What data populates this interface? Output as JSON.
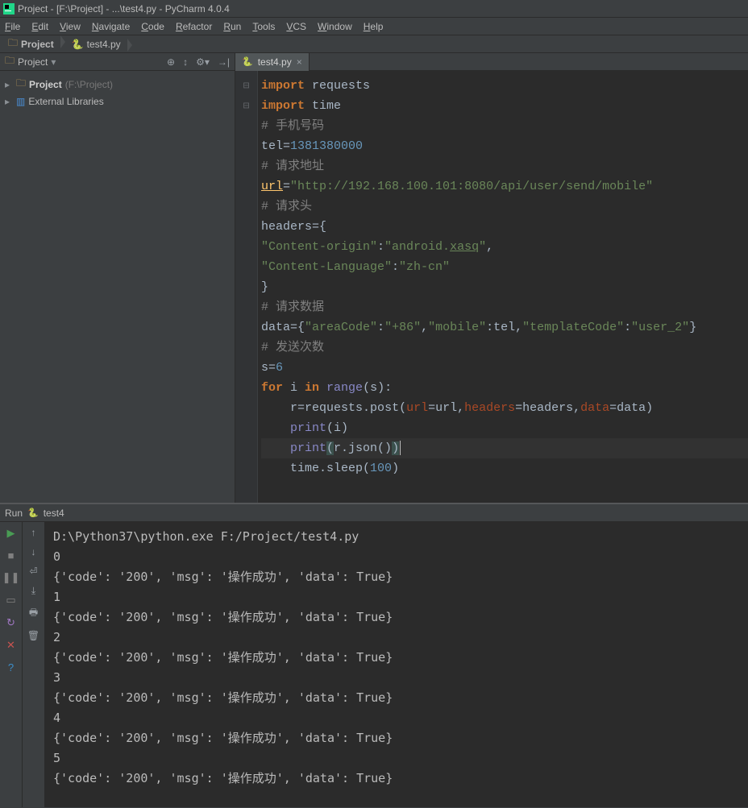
{
  "titlebar": "Project - [F:\\Project] - ...\\test4.py - PyCharm 4.0.4",
  "menu": [
    "File",
    "Edit",
    "View",
    "Navigate",
    "Code",
    "Refactor",
    "Run",
    "Tools",
    "VCS",
    "Window",
    "Help"
  ],
  "breadcrumbs": [
    {
      "icon": "folder",
      "label": "Project"
    },
    {
      "icon": "py",
      "label": "test4.py"
    }
  ],
  "sidebar": {
    "tab_label": "Project",
    "header_icons": [
      "target",
      "autoscroll",
      "gear",
      "hide"
    ],
    "tree": [
      {
        "kind": "project",
        "label": "Project",
        "path": "(F:\\Project)",
        "expanded": true,
        "bold": true
      },
      {
        "kind": "lib",
        "label": "External Libraries",
        "expanded": true
      }
    ]
  },
  "editor": {
    "tab": "test4.py",
    "lines": [
      {
        "type": "import",
        "parts": [
          {
            "t": "import ",
            "cls": "k-import"
          },
          {
            "t": "requests",
            "cls": "ident"
          }
        ]
      },
      {
        "type": "import",
        "parts": [
          {
            "t": "import ",
            "cls": "k-import"
          },
          {
            "t": "time",
            "cls": "ident"
          }
        ]
      },
      {
        "type": "comment",
        "parts": [
          {
            "t": "# 手机号码",
            "cls": "comment"
          }
        ]
      },
      {
        "type": "assign",
        "parts": [
          {
            "t": "tel",
            "cls": "ident"
          },
          {
            "t": "=",
            "cls": "ident"
          },
          {
            "t": "1381380000",
            "cls": "num"
          }
        ]
      },
      {
        "type": "comment",
        "parts": [
          {
            "t": "# 请求地址",
            "cls": "comment"
          }
        ]
      },
      {
        "type": "assign",
        "parts": [
          {
            "t": "url",
            "cls": "warn under"
          },
          {
            "t": "=",
            "cls": "ident"
          },
          {
            "t": "\"http://192.168.100.101:8080/api/user/send/mobile\"",
            "cls": "str"
          }
        ]
      },
      {
        "type": "comment",
        "parts": [
          {
            "t": "# 请求头",
            "cls": "comment"
          }
        ]
      },
      {
        "type": "assign",
        "parts": [
          {
            "t": "headers",
            "cls": "ident"
          },
          {
            "t": "={",
            "cls": "ident"
          }
        ]
      },
      {
        "type": "dict",
        "parts": [
          {
            "t": "\"Content-origin\"",
            "cls": "str"
          },
          {
            "t": ":",
            "cls": "ident"
          },
          {
            "t": "\"android.",
            "cls": "str"
          },
          {
            "t": "xasq",
            "cls": "str under"
          },
          {
            "t": "\"",
            "cls": "str"
          },
          {
            "t": ",",
            "cls": "ident"
          }
        ]
      },
      {
        "type": "dict",
        "parts": [
          {
            "t": "\"Content-Language\"",
            "cls": "str"
          },
          {
            "t": ":",
            "cls": "ident"
          },
          {
            "t": "\"zh-cn\"",
            "cls": "str"
          }
        ]
      },
      {
        "type": "plain",
        "parts": [
          {
            "t": "}",
            "cls": "ident"
          }
        ]
      },
      {
        "type": "comment",
        "parts": [
          {
            "t": "# 请求数据",
            "cls": "comment"
          }
        ]
      },
      {
        "type": "assign",
        "parts": [
          {
            "t": "data",
            "cls": "ident"
          },
          {
            "t": "={",
            "cls": "ident"
          },
          {
            "t": "\"areaCode\"",
            "cls": "str"
          },
          {
            "t": ":",
            "cls": "ident"
          },
          {
            "t": "\"+86\"",
            "cls": "str"
          },
          {
            "t": ",",
            "cls": "ident"
          },
          {
            "t": "\"mobile\"",
            "cls": "str"
          },
          {
            "t": ":tel,",
            "cls": "ident"
          },
          {
            "t": "\"templateCode\"",
            "cls": "str"
          },
          {
            "t": ":",
            "cls": "ident"
          },
          {
            "t": "\"user_2\"",
            "cls": "str"
          },
          {
            "t": "}",
            "cls": "ident"
          }
        ]
      },
      {
        "type": "comment",
        "parts": [
          {
            "t": "# 发送次数",
            "cls": "comment"
          }
        ]
      },
      {
        "type": "assign",
        "parts": [
          {
            "t": "s",
            "cls": "ident"
          },
          {
            "t": "=",
            "cls": "ident"
          },
          {
            "t": "6",
            "cls": "num"
          }
        ]
      },
      {
        "type": "for",
        "parts": [
          {
            "t": "for ",
            "cls": "k-for"
          },
          {
            "t": "i ",
            "cls": "ident"
          },
          {
            "t": "in ",
            "cls": "k-in"
          },
          {
            "t": "range",
            "cls": "builtin"
          },
          {
            "t": "(s):",
            "cls": "ident"
          }
        ]
      },
      {
        "type": "stmt",
        "indent": 1,
        "parts": [
          {
            "t": "r",
            "cls": "ident"
          },
          {
            "t": "=",
            "cls": "ident"
          },
          {
            "t": "requests.post(",
            "cls": "ident"
          },
          {
            "t": "url",
            "cls": "kwarg"
          },
          {
            "t": "=url,",
            "cls": "ident"
          },
          {
            "t": "headers",
            "cls": "kwarg"
          },
          {
            "t": "=headers,",
            "cls": "ident"
          },
          {
            "t": "data",
            "cls": "kwarg"
          },
          {
            "t": "=data)",
            "cls": "ident"
          }
        ]
      },
      {
        "type": "stmt",
        "indent": 1,
        "parts": [
          {
            "t": "print",
            "cls": "builtin"
          },
          {
            "t": "(i)",
            "cls": "ident"
          }
        ]
      },
      {
        "type": "stmt",
        "indent": 1,
        "cursor": true,
        "parts": [
          {
            "t": "print",
            "cls": "builtin"
          },
          {
            "t": "(",
            "cls": "ident paren-hl"
          },
          {
            "t": "r.json()",
            "cls": "ident"
          },
          {
            "t": ")",
            "cls": "ident paren-hl"
          }
        ]
      },
      {
        "type": "stmt",
        "indent": 1,
        "parts": [
          {
            "t": "time.sleep(",
            "cls": "ident"
          },
          {
            "t": "100",
            "cls": "num"
          },
          {
            "t": ")",
            "cls": "ident"
          }
        ]
      }
    ]
  },
  "run": {
    "label": "Run",
    "target": "test4",
    "toolbar_left": [
      "run",
      "stop",
      "pause",
      "layout",
      "rerun",
      "close",
      "help"
    ],
    "toolbar_right": [
      "up",
      "down",
      "wrap",
      "scroll",
      "print",
      "trash"
    ],
    "console": [
      "D:\\Python37\\python.exe F:/Project/test4.py",
      "0",
      "{'code': '200', 'msg': '操作成功', 'data': True}",
      "1",
      "{'code': '200', 'msg': '操作成功', 'data': True}",
      "2",
      "{'code': '200', 'msg': '操作成功', 'data': True}",
      "3",
      "{'code': '200', 'msg': '操作成功', 'data': True}",
      "4",
      "{'code': '200', 'msg': '操作成功', 'data': True}",
      "5",
      "{'code': '200', 'msg': '操作成功', 'data': True}"
    ]
  }
}
